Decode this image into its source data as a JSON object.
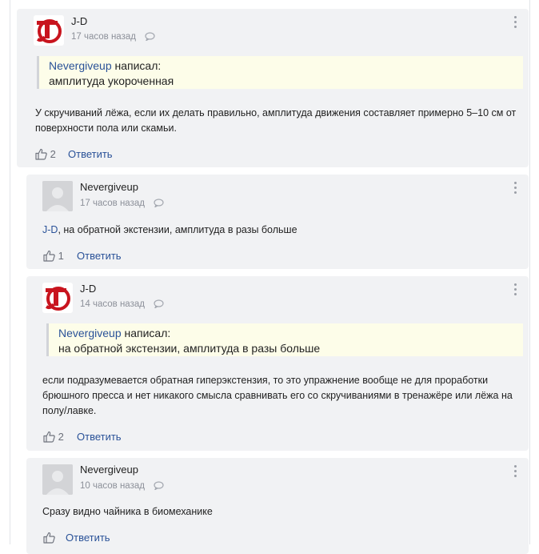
{
  "comments": [
    {
      "author": "J-D",
      "time": "17 часов назад",
      "quote_author": "Nevergiveup",
      "quote_label": "написал:",
      "quote_text": "амплитуда укороченная",
      "text": "У скручиваний лёжа, если их делать правильно, амплитуда движения составляет примерно 5–10 см от поверхности пола или скамьи.",
      "likes": "2",
      "reply": "Ответить"
    },
    {
      "author": "Nevergiveup",
      "time": "17 часов назад",
      "mention": "J-D",
      "text": ", на обратной экстензии, амплитуда в разы больше",
      "likes": "1",
      "reply": "Ответить"
    },
    {
      "author": "J-D",
      "time": "14 часов назад",
      "quote_author": "Nevergiveup",
      "quote_label": "написал:",
      "quote_text": "на обратной экстензии, амплитуда в разы больше",
      "text": "если подразумевается обратная гиперэкстензия, то это упражнение вообще не для проработки брюшного пресса и нет никакого смысла сравнивать его со скручиваниями в тренажёре или лёжа на полу/лавке.",
      "likes": "2",
      "reply": "Ответить"
    },
    {
      "author": "Nevergiveup",
      "time": "10 часов назад",
      "text": "Сразу видно чайника в биомеханике",
      "likes": "",
      "reply": "Ответить"
    }
  ],
  "colors": {
    "link": "#2a5298",
    "card": "#f1f2f4",
    "quote_bg": "#fdfde9",
    "logo_red": "#c8141e"
  },
  "icons": [
    "jd-logo",
    "gray-avatar",
    "comment-bubble-icon",
    "thumbs-up-icon",
    "more-vertical-icon"
  ]
}
